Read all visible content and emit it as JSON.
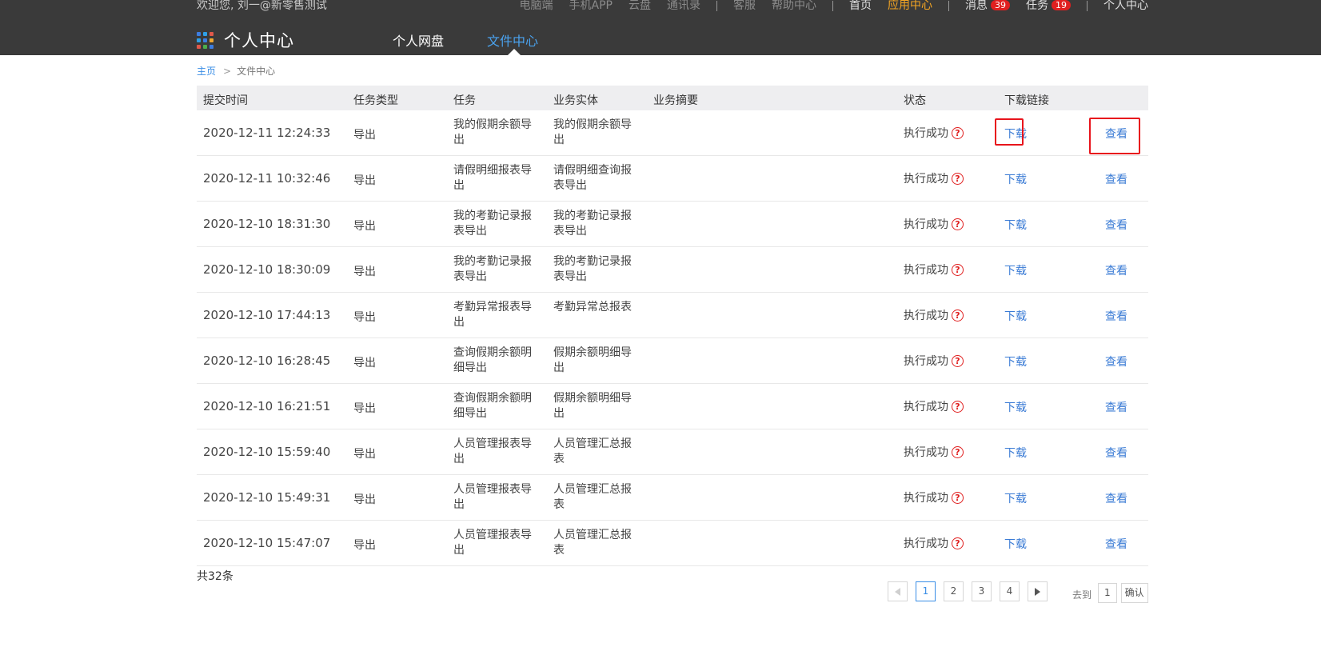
{
  "topbar": {
    "welcome": "欢迎您, 刘一@新零售测试",
    "links": [
      "电脑端",
      "手机APP",
      "云盘",
      "通讯录",
      "客服",
      "帮助中心",
      "首页",
      "应用中心",
      "消息",
      "任务",
      "个人中心"
    ],
    "messages_count": "39",
    "tasks_count": "19"
  },
  "nav": {
    "title": "个人中心",
    "tabs": [
      "个人网盘",
      "文件中心"
    ],
    "active_tab": "文件中心"
  },
  "breadcrumb": {
    "home": "主页",
    "separator": ">",
    "current": "文件中心"
  },
  "table": {
    "headers": [
      "提交时间",
      "任务类型",
      "任务",
      "业务实体",
      "业务摘要",
      "状态",
      "下载链接"
    ],
    "rows": [
      {
        "time": "2020-12-11 12:24:33",
        "type": "导出",
        "task": "我的假期余额导出",
        "entity": "我的假期余额导出",
        "summary": "",
        "status": "执行成功",
        "download": "下载",
        "view": "查看"
      },
      {
        "time": "2020-12-11 10:32:46",
        "type": "导出",
        "task": "请假明细报表导出",
        "entity": "请假明细查询报表导出",
        "summary": "",
        "status": "执行成功",
        "download": "下载",
        "view": "查看"
      },
      {
        "time": "2020-12-10 18:31:30",
        "type": "导出",
        "task": "我的考勤记录报表导出",
        "entity": "我的考勤记录报表导出",
        "summary": "",
        "status": "执行成功",
        "download": "下载",
        "view": "查看"
      },
      {
        "time": "2020-12-10 18:30:09",
        "type": "导出",
        "task": "我的考勤记录报表导出",
        "entity": "我的考勤记录报表导出",
        "summary": "",
        "status": "执行成功",
        "download": "下载",
        "view": "查看"
      },
      {
        "time": "2020-12-10 17:44:13",
        "type": "导出",
        "task": "考勤异常报表导出",
        "entity": "考勤异常总报表",
        "summary": "",
        "status": "执行成功",
        "download": "下载",
        "view": "查看"
      },
      {
        "time": "2020-12-10 16:28:45",
        "type": "导出",
        "task": "查询假期余额明细导出",
        "entity": "假期余额明细导出",
        "summary": "",
        "status": "执行成功",
        "download": "下载",
        "view": "查看"
      },
      {
        "time": "2020-12-10 16:21:51",
        "type": "导出",
        "task": "查询假期余额明细导出",
        "entity": "假期余额明细导出",
        "summary": "",
        "status": "执行成功",
        "download": "下载",
        "view": "查看"
      },
      {
        "time": "2020-12-10 15:59:40",
        "type": "导出",
        "task": "人员管理报表导出",
        "entity": "人员管理汇总报表",
        "summary": "",
        "status": "执行成功",
        "download": "下载",
        "view": "查看"
      },
      {
        "time": "2020-12-10 15:49:31",
        "type": "导出",
        "task": "人员管理报表导出",
        "entity": "人员管理汇总报表",
        "summary": "",
        "status": "执行成功",
        "download": "下载",
        "view": "查看"
      },
      {
        "time": "2020-12-10 15:47:07",
        "type": "导出",
        "task": "人员管理报表导出",
        "entity": "人员管理汇总报表",
        "summary": "",
        "status": "执行成功",
        "download": "下载",
        "view": "查看"
      }
    ]
  },
  "footer": {
    "total": "共32条",
    "pages": [
      "1",
      "2",
      "3",
      "4"
    ],
    "current_page": "1",
    "goto_label": "去到",
    "goto_value": "1",
    "confirm_label": "确认"
  },
  "colors": {
    "header_bg": "#3a3a3a",
    "accent": "#4aa3f0",
    "link": "#3a7bd5",
    "highlight": "#e8141c",
    "warn_orange": "#f5a623",
    "badge_red": "#e02020"
  },
  "icons": [
    "apps-grid-icon",
    "question-circle-icon",
    "prev-page-icon",
    "next-page-icon"
  ]
}
